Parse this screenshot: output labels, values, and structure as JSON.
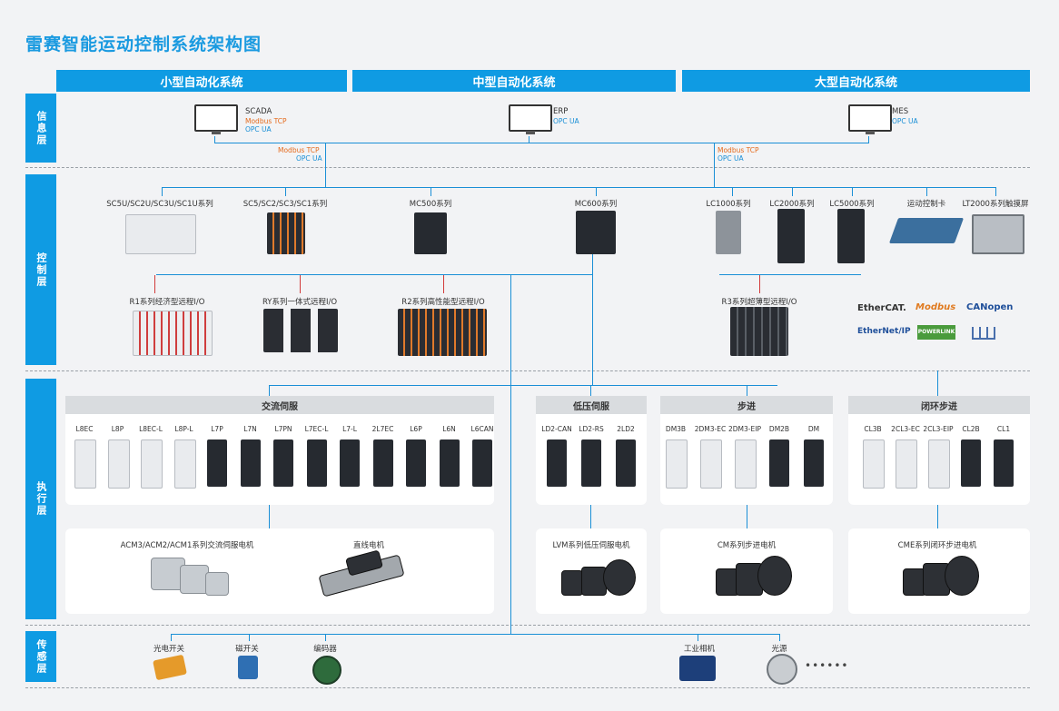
{
  "title": "雷赛智能运动控制系统架构图",
  "headers": [
    "小型自动化系统",
    "中型自动化系统",
    "大型自动化系统"
  ],
  "layers": {
    "info": "信息层",
    "control": "控制层",
    "exec": "执行层",
    "sense": "传感层"
  },
  "info": {
    "scada": {
      "name": "SCADA",
      "p1": "Modbus TCP",
      "p2": "OPC UA"
    },
    "erp": {
      "name": "ERP",
      "p2": "OPC UA"
    },
    "mes": {
      "name": "MES",
      "p2": "OPC UA"
    },
    "link_left": {
      "p1": "Modbus TCP",
      "p2": "OPC UA"
    },
    "link_right": {
      "p1": "Modbus TCP",
      "p2": "OPC UA"
    }
  },
  "control": {
    "controllers": [
      "SC5U/SC2U/SC3U/SC1U系列",
      "SC5/SC2/SC3/SC1系列",
      "MC500系列",
      "MC600系列",
      "LC1000系列",
      "LC2000系列",
      "LC5000系列",
      "运动控制卡",
      "LT2000系列触摸屏"
    ],
    "io": [
      "R1系列经济型远程I/O",
      "RY系列一体式远程I/O",
      "R2系列高性能型远程I/O",
      "R3系列超薄型远程I/O"
    ],
    "protocols": [
      "EtherCAT.",
      "Modbus",
      "CANopen",
      "EtherNet/IP",
      "POWERLINK"
    ]
  },
  "exec": {
    "ac_servo": {
      "title": "交流伺服",
      "models": [
        "L8EC",
        "L8P",
        "L8EC-L",
        "L8P-L",
        "L7P",
        "L7N",
        "L7PN",
        "L7EC-L",
        "L7-L",
        "2L7EC",
        "L6P",
        "L6N",
        "L6CAN"
      ]
    },
    "low_voltage": {
      "title": "低压伺服",
      "models": [
        "LD2-CAN",
        "LD2-RS",
        "2LD2"
      ]
    },
    "stepper": {
      "title": "步进",
      "models": [
        "DM3B",
        "2DM3-EC",
        "2DM3-EIP",
        "DM2B",
        "DM"
      ]
    },
    "closed_loop": {
      "title": "闭环步进",
      "models": [
        "CL3B",
        "2CL3-EC",
        "2CL3-EIP",
        "CL2B",
        "CL1"
      ]
    },
    "motors": {
      "ac": "ACM3/ACM2/ACM1系列交流伺服电机",
      "linear": "直线电机",
      "lvm": "LVM系列低压伺服电机",
      "cm": "CM系列步进电机",
      "cme": "CME系列闭环步进电机"
    }
  },
  "sense": {
    "items": [
      "光电开关",
      "磁开关",
      "编码器",
      "工业相机",
      "光源"
    ],
    "more": "••••••"
  },
  "colors": {
    "accent": "#0f9be3",
    "line": "#1a8fd6",
    "io_line": "#d23a3a",
    "protocol": "#e56a1c"
  }
}
